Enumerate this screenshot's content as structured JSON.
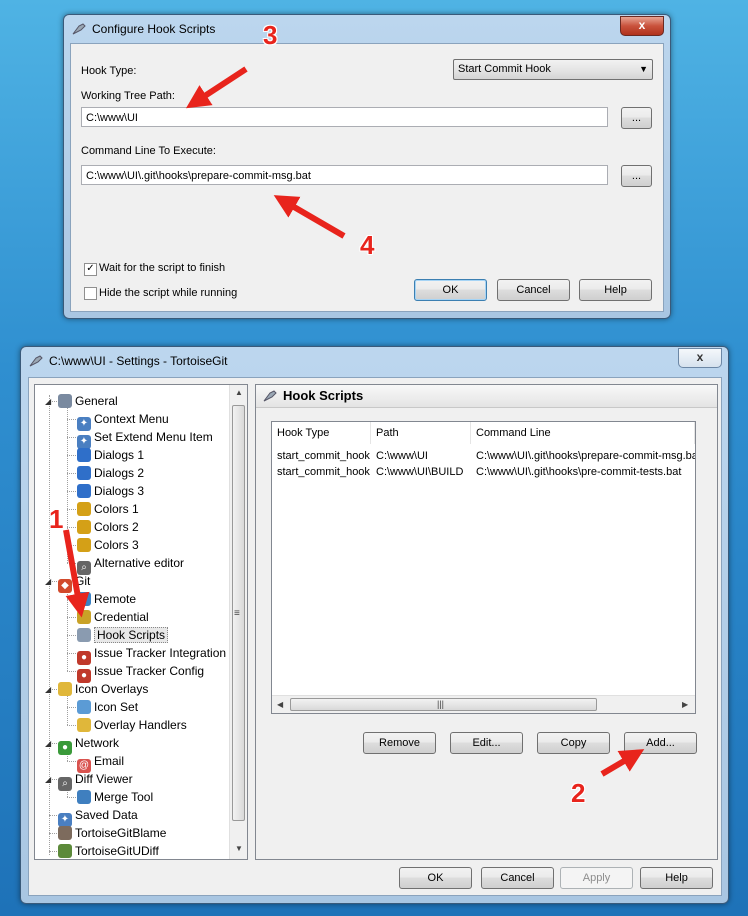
{
  "hook_dialog": {
    "title": "Configure Hook Scripts",
    "close_label": "x",
    "hook_type_label": "Hook Type:",
    "hook_type_value": "Start Commit Hook",
    "working_tree_label": "Working Tree Path:",
    "working_tree_value": "C:\\www\\UI",
    "browse_label": "...",
    "command_line_label": "Command Line To Execute:",
    "command_line_value": "C:\\www\\UI\\.git\\hooks\\prepare-commit-msg.bat",
    "wait_label": "Wait for the script to finish",
    "wait_checked": true,
    "hide_label": "Hide the script while running",
    "hide_checked": false,
    "ok": "OK",
    "cancel": "Cancel",
    "help": "Help"
  },
  "settings": {
    "title": "C:\\www\\UI - Settings - TortoiseGit",
    "close_label": "x",
    "tree": [
      {
        "label": "General",
        "icon": "wrench-icon"
      },
      {
        "label": "Context Menu",
        "icon": "gear-icon"
      },
      {
        "label": "Set Extend Menu Item",
        "icon": "gear-icon"
      },
      {
        "label": "Dialogs 1",
        "icon": "dialogs-icon"
      },
      {
        "label": "Dialogs 2",
        "icon": "dialogs-icon"
      },
      {
        "label": "Dialogs 3",
        "icon": "dialogs-icon"
      },
      {
        "label": "Colors 1",
        "icon": "colors-icon"
      },
      {
        "label": "Colors 2",
        "icon": "colors-icon"
      },
      {
        "label": "Colors 3",
        "icon": "colors-icon"
      },
      {
        "label": "Alternative editor",
        "icon": "magnifier-icon"
      },
      {
        "label": "Git",
        "icon": "git-icon"
      },
      {
        "label": "Remote",
        "icon": "remote-icon"
      },
      {
        "label": "Credential",
        "icon": "key-icon"
      },
      {
        "label": "Hook Scripts",
        "icon": "hook-icon"
      },
      {
        "label": "Issue Tracker Integration",
        "icon": "bug-icon"
      },
      {
        "label": "Issue Tracker Config",
        "icon": "bug-icon"
      },
      {
        "label": "Icon Overlays",
        "icon": "folder-icon"
      },
      {
        "label": "Icon Set",
        "icon": "iconset-icon"
      },
      {
        "label": "Overlay Handlers",
        "icon": "folder-icon"
      },
      {
        "label": "Network",
        "icon": "globe-icon"
      },
      {
        "label": "Email",
        "icon": "at-icon"
      },
      {
        "label": "Diff Viewer",
        "icon": "magnifier-icon"
      },
      {
        "label": "Merge Tool",
        "icon": "merge-icon"
      },
      {
        "label": "Saved Data",
        "icon": "gear-icon"
      },
      {
        "label": "TortoiseGitBlame",
        "icon": "blame-icon"
      },
      {
        "label": "TortoiseGitUDiff",
        "icon": "udiff-icon"
      }
    ],
    "panel_title": "Hook Scripts",
    "columns": [
      "Hook Type",
      "Path",
      "Command Line"
    ],
    "rows": [
      [
        "start_commit_hook",
        "C:\\www\\UI",
        "C:\\www\\UI\\.git\\hooks\\prepare-commit-msg.bat"
      ],
      [
        "start_commit_hook",
        "C:\\www\\UI\\BUILD",
        "C:\\www\\UI\\.git\\hooks\\pre-commit-tests.bat"
      ]
    ],
    "remove": "Remove",
    "edit": "Edit...",
    "copy": "Copy",
    "add": "Add...",
    "ok": "OK",
    "cancel": "Cancel",
    "apply": "Apply",
    "help": "Help"
  },
  "annotations": {
    "n1": "1",
    "n2": "2",
    "n3": "3",
    "n4": "4",
    "color": "#e8241c"
  }
}
